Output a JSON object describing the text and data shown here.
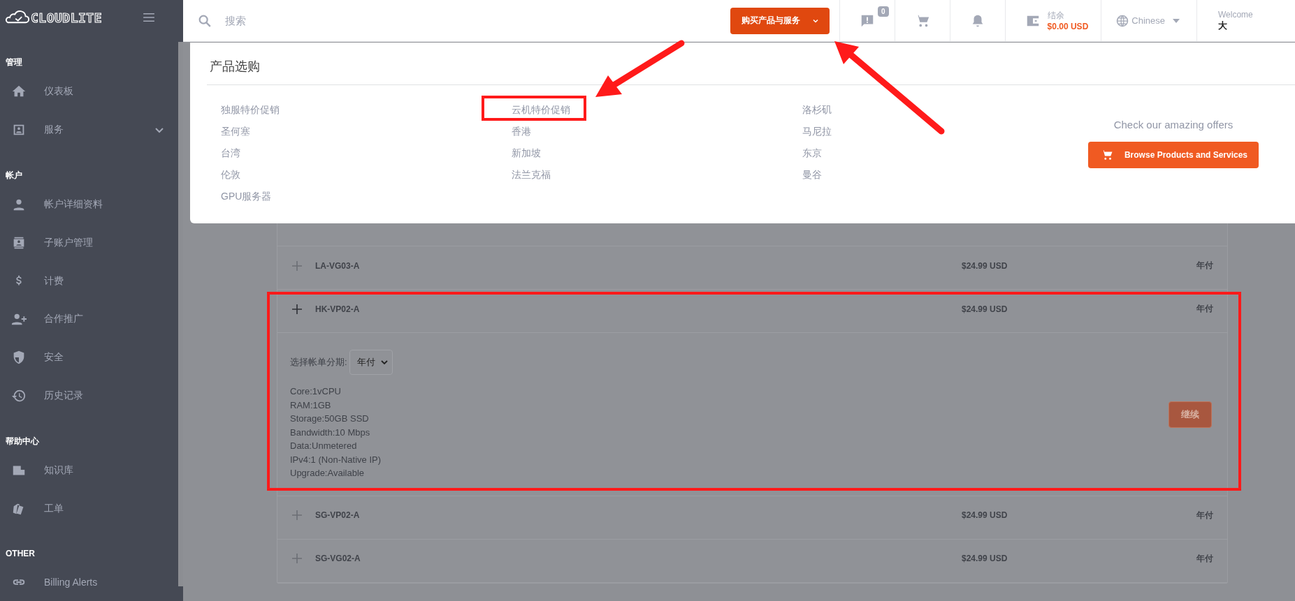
{
  "sidebar": {
    "logo": "CLOUDLITE",
    "sections": [
      {
        "title": "管理",
        "items": [
          {
            "label": "仪表板"
          },
          {
            "label": "服务",
            "expanded": false
          }
        ]
      },
      {
        "title": "帐户",
        "items": [
          {
            "label": "帐户详细资料"
          },
          {
            "label": "子账户管理"
          },
          {
            "label": "计费"
          },
          {
            "label": "合作推广"
          },
          {
            "label": "安全"
          },
          {
            "label": "历史记录"
          }
        ]
      },
      {
        "title": "帮助中心",
        "items": [
          {
            "label": "知识库"
          },
          {
            "label": "工单"
          }
        ]
      },
      {
        "title": "OTHER",
        "items": [
          {
            "label": "Billing Alerts"
          }
        ]
      }
    ]
  },
  "top_bar": {
    "search": {
      "placeholder": "搜索"
    },
    "buy_button": "购买产品与服务",
    "messages_badge": "0",
    "balance": {
      "label": "结余",
      "amount": "$0.00 USD"
    },
    "language": "Chinese",
    "welcome": "Welcome",
    "user": "大"
  },
  "products_menu": {
    "title": "产品选购",
    "columns": [
      [
        "独服特价促销",
        "圣何塞",
        "台湾",
        "伦敦",
        "GPU服务器"
      ],
      [
        "云机特价促销",
        "香港",
        "新加坡",
        "法兰克福"
      ],
      [
        "洛杉矶",
        "马尼拉",
        "东京",
        "曼谷"
      ]
    ],
    "offers_text": "Check our amazing offers",
    "browse_button": "Browse Products and Services"
  },
  "products": [
    {
      "name": "LA-VG03-A",
      "price": "$24.99 USD",
      "cycle": "年付",
      "expanded": false
    },
    {
      "name": "HK-VP02-A",
      "price": "$24.99 USD",
      "cycle": "年付",
      "expanded": true
    },
    {
      "name": "SG-VP02-A",
      "price": "$24.99 USD",
      "cycle": "年付",
      "expanded": false
    },
    {
      "name": "SG-VG02-A",
      "price": "$24.99 USD",
      "cycle": "年付",
      "expanded": false
    }
  ],
  "details": {
    "billing_label": "选择帐单分期:",
    "billing_value": "年付",
    "specs": [
      "Core:1vCPU",
      "RAM:1GB",
      "Storage:50GB SSD",
      "Bandwidth:10 Mbps",
      "Data:Unmetered",
      "IPv4:1 (Non-Native IP)",
      "Upgrade:Available"
    ],
    "continue_button": "继续"
  }
}
